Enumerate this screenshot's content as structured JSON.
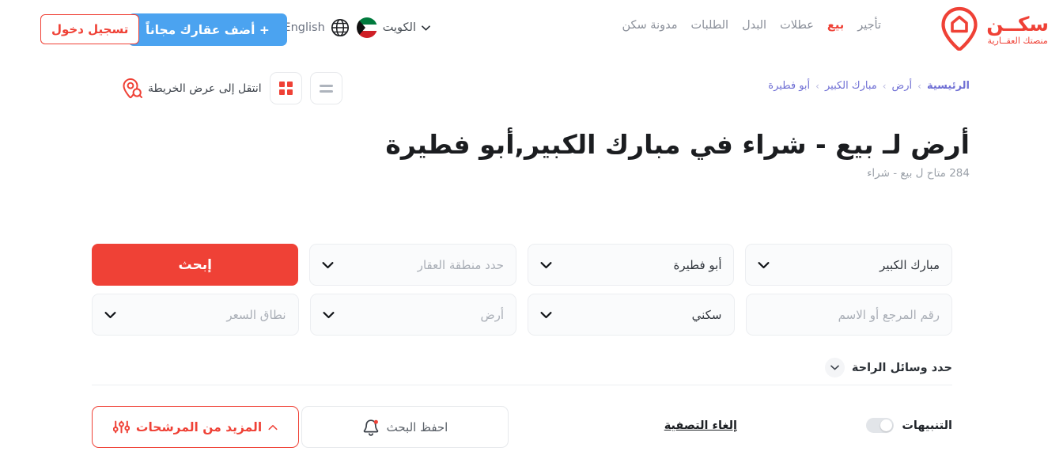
{
  "brand": {
    "name": "سكــن",
    "tagline": "منصتك العقــارية",
    "accent_color": "#ef4136",
    "logo_icon": "map-pin-home-icon"
  },
  "header": {
    "nav_items": [
      {
        "label": "تأجير",
        "active": false
      },
      {
        "label": "بيع",
        "active": true
      },
      {
        "label": "عطلات",
        "active": false
      },
      {
        "label": "البدل",
        "active": false
      },
      {
        "label": "الطلبات",
        "active": false
      },
      {
        "label": "مدونة سكن",
        "active": false
      }
    ],
    "language": {
      "label": "English",
      "icon": "globe-icon"
    },
    "country": {
      "label": "الكويت",
      "flag": "kuwait-flag-icon",
      "chevron": "chevron-down-icon"
    },
    "add_property_button": "+ أضف عقارك مجاناً",
    "login_button": "تسجيل دخول",
    "add_button_color": "#4ba3f0"
  },
  "subheader": {
    "breadcrumb": [
      {
        "label": "الرئيسية"
      },
      {
        "label": "أرض"
      },
      {
        "label": "مبارك الكبير"
      },
      {
        "label": "أبو فطيرة"
      }
    ],
    "breadcrumb_separator": "›",
    "map_link": "انتقل إلى عرض الخريطة",
    "map_link_icon": "map-pin-search-icon",
    "view_grid_icon": "grid-view-icon",
    "view_list_icon": "list-view-icon",
    "active_view": "grid"
  },
  "main": {
    "title": "أرض لـ بيع - شراء في مبارك الكبير,أبو فطيرة",
    "subtitle": "284 متاح ل بيع - شراء",
    "result_count": "284"
  },
  "search": {
    "row1": [
      {
        "name": "governorate",
        "value": "مبارك الكبير",
        "filled": true,
        "chevron": true
      },
      {
        "name": "area",
        "value": "أبو فطيرة",
        "filled": true,
        "chevron": true
      },
      {
        "name": "property-region",
        "value": "حدد منطقة العقار",
        "filled": false,
        "chevron": true
      }
    ],
    "search_button": "إبحث",
    "row2": [
      {
        "name": "reference-or-name",
        "value": "رقم المرجع أو الاسم",
        "filled": false,
        "chevron": false
      },
      {
        "name": "category",
        "value": "سكني",
        "filled": true,
        "chevron": true
      },
      {
        "name": "property-type",
        "value": "أرض",
        "filled": false,
        "chevron": true
      },
      {
        "name": "price-range",
        "value": "نطاق السعر",
        "filled": false,
        "chevron": true
      }
    ],
    "amenities_label": "حدد وسائل الراحة",
    "amenities_chevron": "chevron-down-icon"
  },
  "actions": {
    "alerts_label": "التنبيهات",
    "alerts_on": false,
    "clear_filters": "إلغاء التصفية",
    "save_search": "احفظ البحث",
    "save_search_icon": "bell-icon",
    "more_filters": "المزيد من المرشحات",
    "more_filters_icon": "sliders-icon",
    "more_filters_chevron": "chevron-up-icon"
  }
}
